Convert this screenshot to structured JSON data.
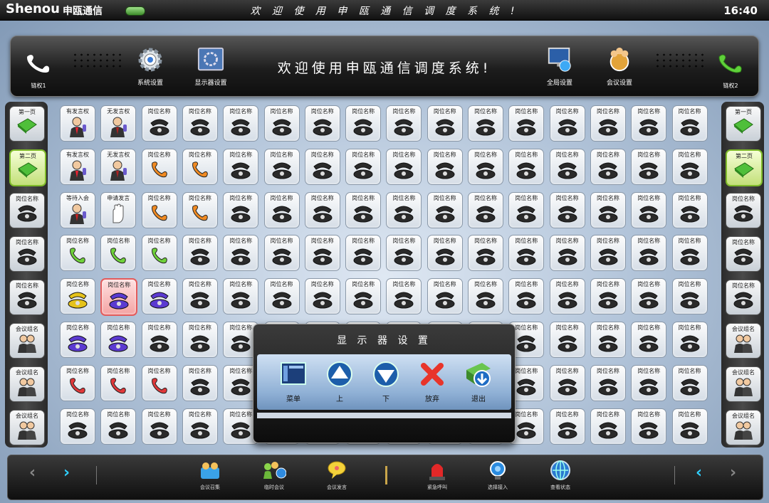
{
  "top": {
    "logo": "Shenou",
    "logo_cn": "申瓯通信",
    "title": "欢 迎 使 用 申 瓯 通 信 调 度 系 统 !",
    "clock": "16:40"
  },
  "header": {
    "left_hook_label": "链权1",
    "right_hook_label": "链权2",
    "title": "欢迎使用申瓯通信调度系统!",
    "buttons": [
      {
        "label": "系统设置",
        "icon": "gear-icon"
      },
      {
        "label": "显示器设置",
        "icon": "display-icon"
      },
      {
        "label": "全局设置",
        "icon": "monitor-icon"
      },
      {
        "label": "会议设置",
        "icon": "meeting-icon"
      }
    ]
  },
  "left_panel": [
    {
      "label": "第一页",
      "icon": "book-icon"
    },
    {
      "label": "第二页",
      "icon": "book-icon",
      "active": true
    },
    {
      "label": "岗位名称",
      "icon": "phone-icon"
    },
    {
      "label": "岗位名称",
      "icon": "phone-icon"
    },
    {
      "label": "岗位名称",
      "icon": "phone-icon"
    },
    {
      "label": "会议组名",
      "icon": "group-icon"
    },
    {
      "label": "会议组名",
      "icon": "group-icon"
    },
    {
      "label": "会议组名",
      "icon": "group-icon"
    }
  ],
  "right_panel": [
    {
      "label": "第一页",
      "icon": "book-icon"
    },
    {
      "label": "第二页",
      "icon": "book-icon",
      "active": true
    },
    {
      "label": "岗位名称",
      "icon": "phone-icon"
    },
    {
      "label": "岗位名称",
      "icon": "phone-icon"
    },
    {
      "label": "岗位名称",
      "icon": "phone-icon"
    },
    {
      "label": "会议组名",
      "icon": "group-icon"
    },
    {
      "label": "会议组名",
      "icon": "group-icon"
    },
    {
      "label": "会议组名",
      "icon": "group-icon"
    }
  ],
  "grid": {
    "default_label": "岗位名称",
    "special": [
      {
        "row": 0,
        "col": 0,
        "label": "有发言权",
        "icon": "speaker-person-icon"
      },
      {
        "row": 0,
        "col": 1,
        "label": "无发言权",
        "icon": "muted-person-icon"
      },
      {
        "row": 1,
        "col": 0,
        "label": "有发言权",
        "icon": "speaker-person-icon"
      },
      {
        "row": 1,
        "col": 1,
        "label": "无发言权",
        "icon": "muted-person-icon"
      },
      {
        "row": 1,
        "col": 2,
        "label": "岗位名称",
        "icon": "orange-phone-icon"
      },
      {
        "row": 1,
        "col": 3,
        "label": "岗位名称",
        "icon": "orange-phone-ringing-icon"
      },
      {
        "row": 2,
        "col": 0,
        "label": "等待入会",
        "icon": "waiting-person-icon"
      },
      {
        "row": 2,
        "col": 1,
        "label": "申请发言",
        "icon": "hand-raise-icon"
      },
      {
        "row": 2,
        "col": 2,
        "label": "岗位名称",
        "icon": "orange-phone-icon"
      },
      {
        "row": 2,
        "col": 3,
        "label": "岗位名称",
        "icon": "orange-phone-transfer-icon"
      },
      {
        "row": 3,
        "col": 0,
        "label": "岗位名称",
        "icon": "green-handset-icon"
      },
      {
        "row": 3,
        "col": 1,
        "label": "岗位名称",
        "icon": "green-handset-icon"
      },
      {
        "row": 3,
        "col": 2,
        "label": "岗位名称",
        "icon": "green-handset-icon"
      },
      {
        "row": 4,
        "col": 0,
        "label": "岗位名称",
        "icon": "yellow-phone-icon"
      },
      {
        "row": 4,
        "col": 1,
        "label": "岗位名称",
        "icon": "purple-phone-icon",
        "selected": true
      },
      {
        "row": 4,
        "col": 2,
        "label": "岗位名称",
        "icon": "purple-phone-icon"
      },
      {
        "row": 5,
        "col": 0,
        "label": "岗位名称",
        "icon": "purple-phone-check-icon"
      },
      {
        "row": 5,
        "col": 1,
        "label": "岗位名称",
        "icon": "purple-phone-gear-icon"
      },
      {
        "row": 6,
        "col": 0,
        "label": "岗位名称",
        "icon": "red-handset-icon"
      },
      {
        "row": 6,
        "col": 1,
        "label": "岗位名称",
        "icon": "red-handset-arrow-icon"
      },
      {
        "row": 6,
        "col": 2,
        "label": "岗位名称",
        "icon": "red-handset-screen-icon"
      }
    ]
  },
  "modal": {
    "title": "显 示 器 设 置",
    "buttons": [
      {
        "label": "菜单",
        "icon": "menu-icon"
      },
      {
        "label": "上",
        "icon": "up-arrow-icon"
      },
      {
        "label": "下",
        "icon": "down-arrow-icon"
      },
      {
        "label": "放弃",
        "icon": "cancel-x-icon"
      },
      {
        "label": "退出",
        "icon": "exit-icon"
      }
    ]
  },
  "bottom": {
    "left_prev": "‹",
    "left_next": "›",
    "right_prev": "‹",
    "right_next": "›",
    "buttons": [
      {
        "label": "会议召集",
        "icon": "meeting-call-icon"
      },
      {
        "label": "临时会议",
        "icon": "temp-meeting-icon"
      },
      {
        "label": "会议发言",
        "icon": "meeting-speak-icon"
      },
      {
        "label": "紧急呼叫",
        "icon": "alarm-icon"
      },
      {
        "label": "选择接入",
        "icon": "select-access-icon"
      },
      {
        "label": "查看状态",
        "icon": "status-globe-icon"
      }
    ]
  }
}
